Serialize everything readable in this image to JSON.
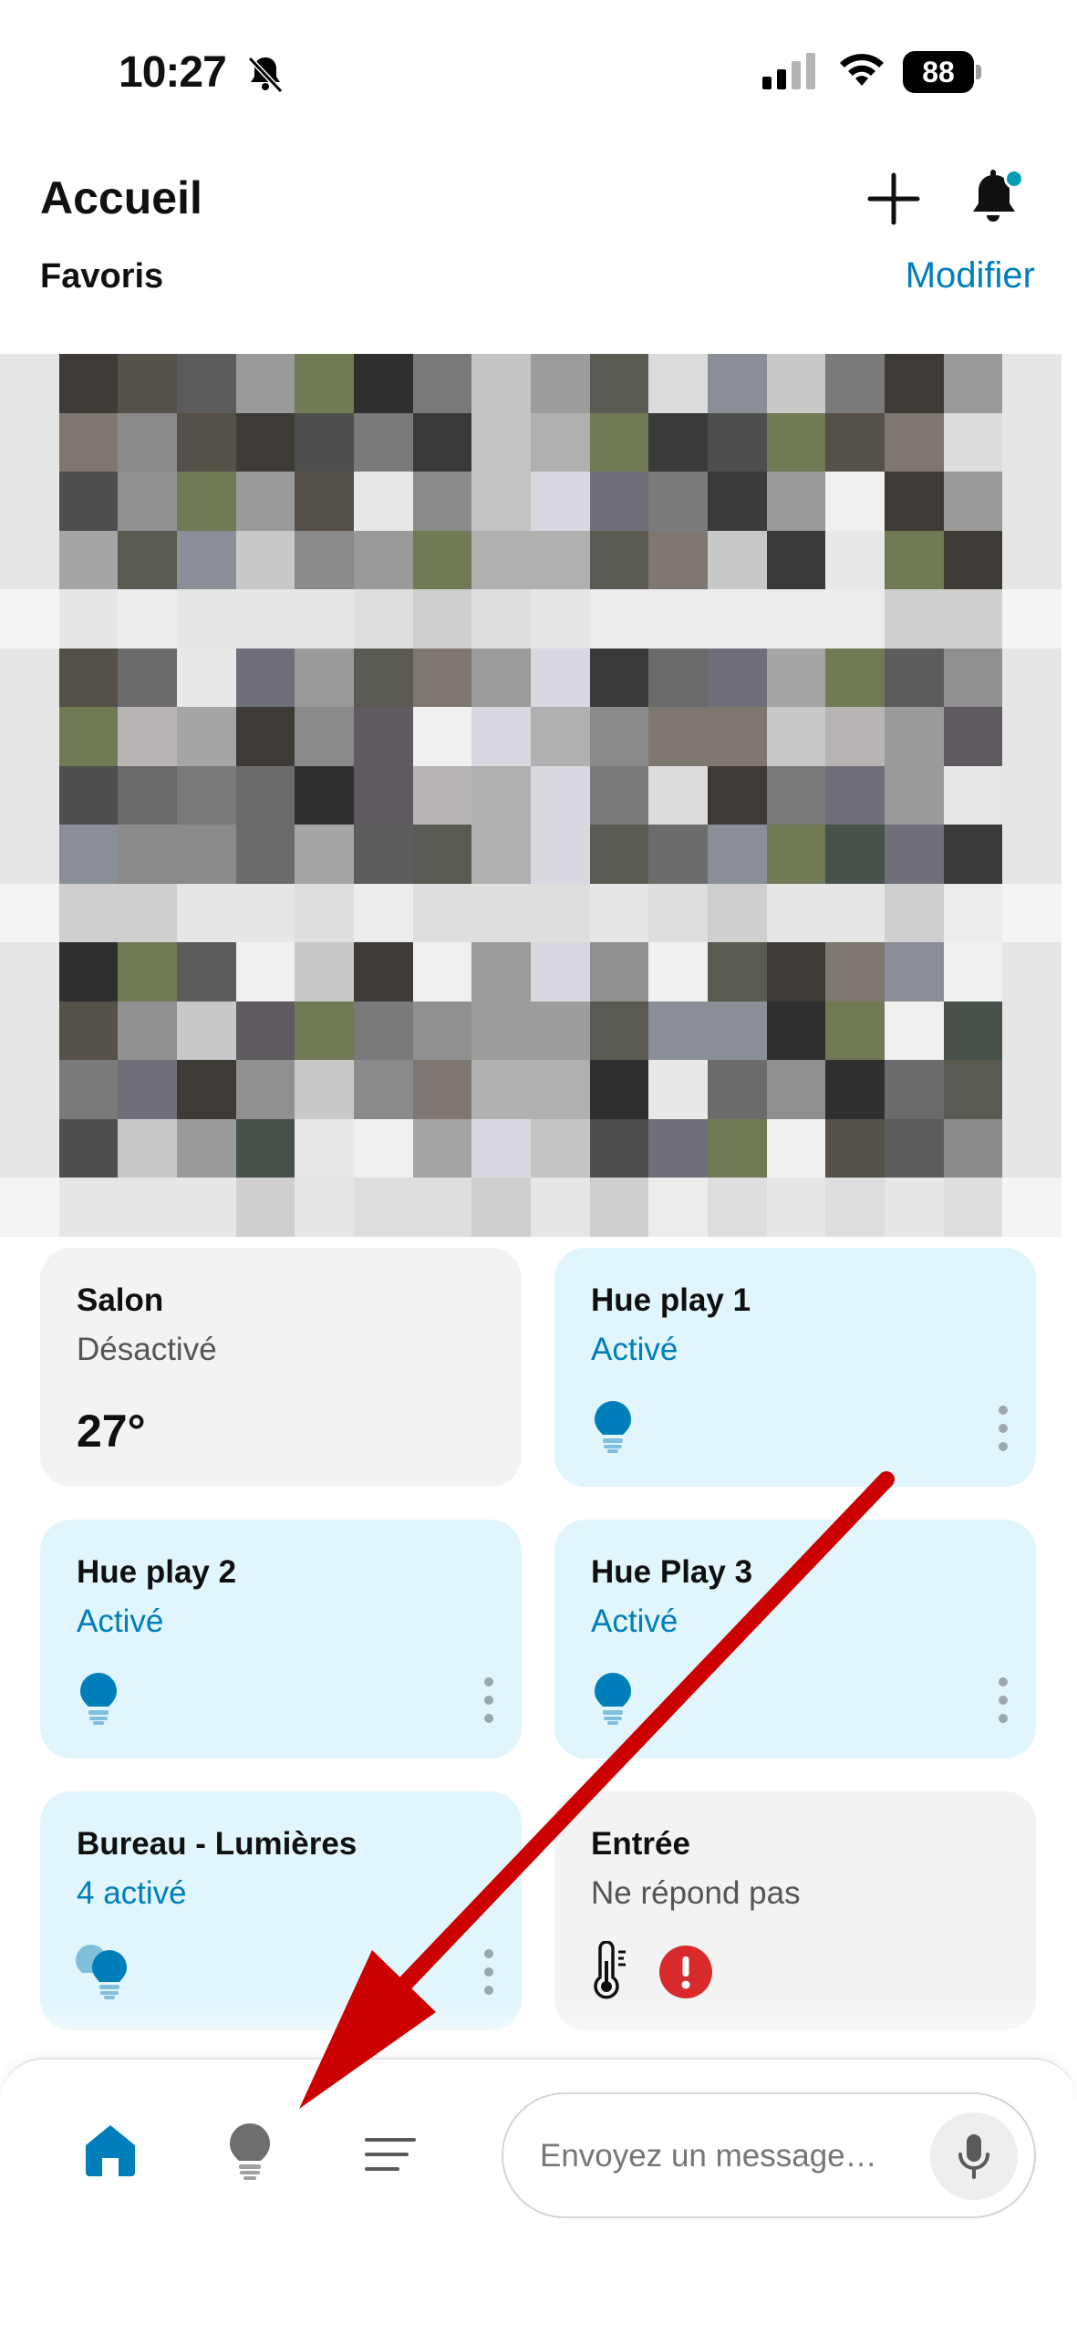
{
  "status_bar": {
    "time": "10:27",
    "battery": "88",
    "icons": [
      "bell-slash-icon",
      "cellular-signal-icon",
      "wifi-icon",
      "battery-icon"
    ]
  },
  "header": {
    "title": "Accueil",
    "add_icon": "plus-icon",
    "notifications_icon": "bell-icon",
    "notification_dot_color": "#00a0b4"
  },
  "favorites": {
    "title": "Favoris",
    "edit_label": "Modifier"
  },
  "camera": {
    "blurred": true
  },
  "tiles": [
    {
      "title": "Salon",
      "status": "Désactivé",
      "value": "27°",
      "state": "off"
    },
    {
      "title": "Hue play 1",
      "status": "Activé",
      "icon": "lightbulb-icon",
      "state": "on"
    },
    {
      "title": "Hue play 2",
      "status": "Activé",
      "icon": "lightbulb-icon",
      "state": "on"
    },
    {
      "title": "Hue Play 3",
      "status": "Activé",
      "icon": "lightbulb-icon",
      "state": "on"
    },
    {
      "title": "Bureau - Lumières",
      "status": "4 activé",
      "icon": "lightbulb-group-icon",
      "state": "on"
    },
    {
      "title": "Entrée",
      "status": "Ne répond pas",
      "icon": "thermometer-icon",
      "alert_icon": "alert-icon",
      "state": "off"
    }
  ],
  "bottom_nav": {
    "items": [
      "home-icon",
      "lightbulb-icon",
      "menu-lines-icon"
    ],
    "message_placeholder": "Envoyez un message…",
    "mic_icon": "microphone-icon"
  },
  "colors": {
    "accent": "#007eb9",
    "tile_on": "#e1f5fc",
    "tile_off": "#f3f3f3",
    "alert": "#d82a2a",
    "arrow": "#cc0000"
  }
}
